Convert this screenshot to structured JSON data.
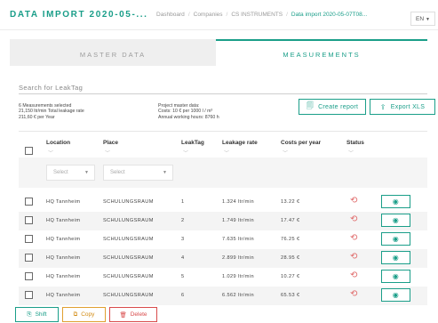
{
  "header": {
    "title": "DATA IMPORT 2020-05-...",
    "breadcrumbs": [
      "Dashboard",
      "Companies",
      "CS INSTRUMENTS",
      "Data import 2020-05-07T08..."
    ],
    "language": "EN"
  },
  "tabs": [
    {
      "label": "MASTER DATA",
      "active": false
    },
    {
      "label": "MEASUREMENTS",
      "active": true
    }
  ],
  "search": {
    "placeholder": "Search for LeakTag"
  },
  "summary": {
    "left": [
      "6 Measurements selected",
      "21,150 ltr/min Total leakage rate",
      "211,60 € per Year"
    ],
    "middle": [
      "Project master data:",
      "Costs: 10 € per 1000 l / m³",
      "Annual working hours: 8760 h"
    ]
  },
  "actions": {
    "create_report": "Create report",
    "export_xls": "Export XLS"
  },
  "table": {
    "columns": [
      "Location",
      "Place",
      "LeakTag",
      "Leakage rate",
      "Costs per year",
      "Status"
    ],
    "filters": {
      "location": "Select",
      "place": "Select"
    },
    "rows": [
      {
        "location": "HQ Tannheim",
        "place": "SCHULUNGSRAUM",
        "leaktag": "1",
        "rate": "1.324 ltr/min",
        "cost": "13.22 €"
      },
      {
        "location": "HQ Tannheim",
        "place": "SCHULUNGSRAUM",
        "leaktag": "2",
        "rate": "1.749 ltr/min",
        "cost": "17.47 €"
      },
      {
        "location": "HQ Tannheim",
        "place": "SCHULUNGSRAUM",
        "leaktag": "3",
        "rate": "7.635 ltr/min",
        "cost": "76.25 €"
      },
      {
        "location": "HQ Tannheim",
        "place": "SCHULUNGSRAUM",
        "leaktag": "4",
        "rate": "2.899 ltr/min",
        "cost": "28.95 €"
      },
      {
        "location": "HQ Tannheim",
        "place": "SCHULUNGSRAUM",
        "leaktag": "5",
        "rate": "1.029 ltr/min",
        "cost": "10.27 €"
      },
      {
        "location": "HQ Tannheim",
        "place": "SCHULUNGSRAUM",
        "leaktag": "6",
        "rate": "6.562 ltr/min",
        "cost": "65.53 €"
      }
    ]
  },
  "bottom": {
    "shift": "Shift",
    "copy": "Copy",
    "delete": "Delete"
  },
  "icons": {
    "report": "report-icon",
    "export": "export-icon",
    "status": "history-icon",
    "view": "eye-icon",
    "shift": "shift-icon",
    "copy": "copy-icon",
    "delete": "trash-icon"
  },
  "colors": {
    "accent": "#1a9e89",
    "danger": "#d84b4b",
    "warning": "#e0a030"
  }
}
